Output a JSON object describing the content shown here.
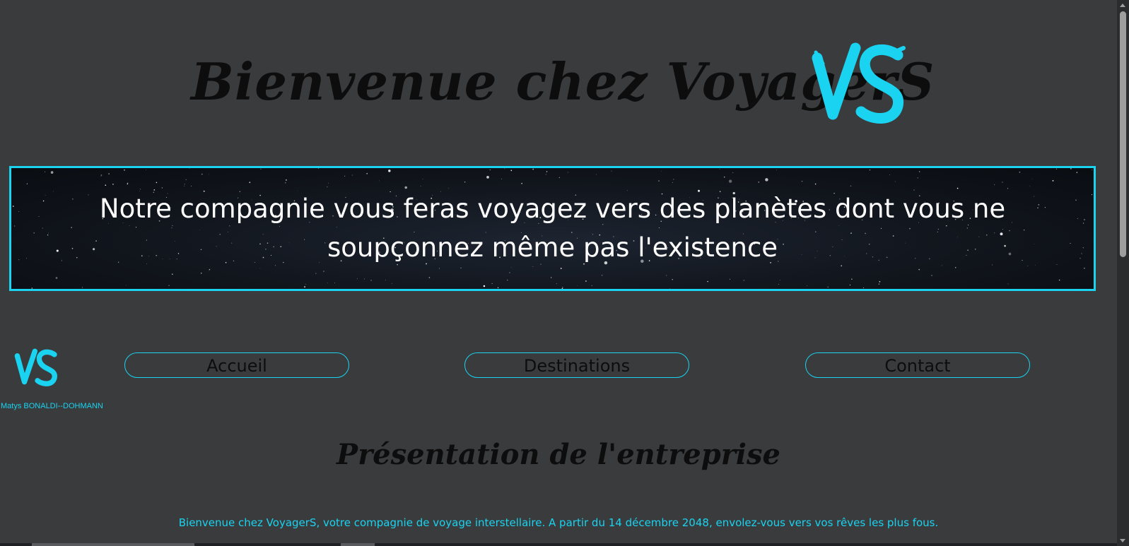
{
  "header": {
    "title": "Bienvenue chez VoyagerS",
    "logo_text": "VS"
  },
  "hero": {
    "text": "Notre compagnie vous feras voyagez vers des planètes dont vous ne soupçonnez même pas l'existence"
  },
  "sidebar": {
    "logo_text": "VS",
    "author": "Matys BONALDI--DOHMANN"
  },
  "nav": {
    "items": [
      {
        "label": "Accueil"
      },
      {
        "label": "Destinations"
      },
      {
        "label": "Contact"
      }
    ]
  },
  "main": {
    "section_title": "Présentation de l'entreprise",
    "intro": "Bienvenue chez VoyagerS, votre compagnie de voyage interstellaire. A partir du 14 décembre 2048, envolez-vous vers vos rêves les plus fous."
  },
  "colors": {
    "background": "#3a3b3d",
    "accent": "#19d3f0",
    "title_text": "#0d0d0d"
  }
}
